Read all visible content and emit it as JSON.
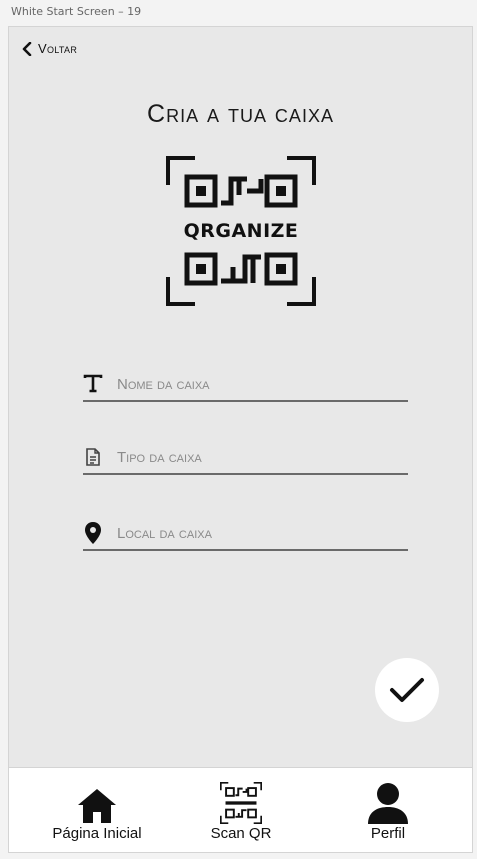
{
  "artboard": {
    "label": "White Start Screen – 19"
  },
  "header": {
    "back_label": "Voltar"
  },
  "page": {
    "title": "Cria a tua caixa"
  },
  "logo": {
    "text": "QRGANIZE"
  },
  "form": {
    "fields": [
      {
        "placeholder": "Nome da caixa",
        "value": "",
        "icon": "text-icon"
      },
      {
        "placeholder": "Tipo da caixa",
        "value": "",
        "icon": "document-icon"
      },
      {
        "placeholder": "Local da caixa",
        "value": "",
        "icon": "location-pin-icon"
      }
    ]
  },
  "actions": {
    "confirm_icon": "checkmark-icon"
  },
  "nav": {
    "items": [
      {
        "label": "Página Inicial",
        "icon": "home-icon"
      },
      {
        "label": "Scan QR",
        "icon": "qr-logo-icon"
      },
      {
        "label": "Perfil",
        "icon": "user-icon"
      }
    ]
  },
  "colors": {
    "background": "#e8e8e8",
    "foreground": "#111111",
    "nav_background": "#ffffff"
  }
}
